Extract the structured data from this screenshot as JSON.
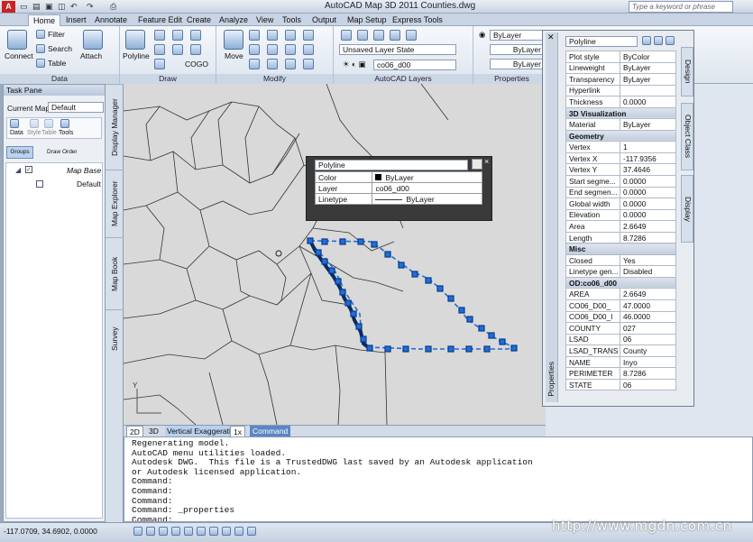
{
  "title_bar": {
    "title": "AutoCAD Map 3D 2011    Counties.dwg",
    "search_placeholder": "Type a keyword or phrase",
    "app_letter": "A"
  },
  "ribbon_tabs": [
    "Home",
    "Insert",
    "Annotate",
    "Feature Edit",
    "Create",
    "Analyze",
    "View",
    "Tools",
    "Output",
    "Map Setup",
    "Express Tools"
  ],
  "ribbon": {
    "data": {
      "label": "Data",
      "connect": "Connect",
      "filter": "Filter",
      "search": "Search",
      "table": "Table",
      "attach": "Attach"
    },
    "draw": {
      "label": "Draw",
      "polyline": "Polyline",
      "cogo": "COGO"
    },
    "modify": {
      "label": "Modify",
      "move": "Move"
    },
    "layers": {
      "label": "AutoCAD Layers",
      "layer_state": "Unsaved Layer State",
      "current_layer": "co06_d00"
    },
    "properties": {
      "label": "Properties",
      "color": "ByLayer",
      "lineweight": "ByLayer",
      "linetype": "ByLayer"
    }
  },
  "task_pane": {
    "title": "Task Pane",
    "current_map_label": "Current Map:",
    "current_map": "Default",
    "tools": [
      "Data",
      "Style",
      "Table",
      "Tools"
    ],
    "groups_btn": "Groups",
    "draw_order_btn": "Draw Order",
    "tree": [
      {
        "label": "Map Base"
      },
      {
        "label": "Default"
      }
    ]
  },
  "side_tabs": [
    "Display Manager",
    "Map Explorer",
    "Map Book",
    "Survey"
  ],
  "quick_props": {
    "type": "Polyline",
    "rows": [
      {
        "k": "Color",
        "v": "ByLayer"
      },
      {
        "k": "Layer",
        "v": "co06_d00"
      },
      {
        "k": "Linetype",
        "v": "ByLayer"
      }
    ]
  },
  "properties_palette": {
    "type": "Polyline",
    "vertical_title": "Properties",
    "right_tabs": [
      "Design",
      "Object Class",
      "Display"
    ],
    "rows": [
      {
        "k": "Plot style",
        "v": "ByColor"
      },
      {
        "k": "Lineweight",
        "v": "ByLayer"
      },
      {
        "k": "Transparency",
        "v": "ByLayer"
      },
      {
        "k": "Hyperlink",
        "v": ""
      },
      {
        "k": "Thickness",
        "v": "0.0000"
      },
      {
        "section": "3D Visualization"
      },
      {
        "k": "Material",
        "v": "ByLayer"
      },
      {
        "section": "Geometry"
      },
      {
        "k": "Vertex",
        "v": "1"
      },
      {
        "k": "Vertex X",
        "v": "-117.9356"
      },
      {
        "k": "Vertex Y",
        "v": "37.4646"
      },
      {
        "k": "Start segme...",
        "v": "0.0000"
      },
      {
        "k": "End segmen...",
        "v": "0.0000"
      },
      {
        "k": "Global width",
        "v": "0.0000"
      },
      {
        "k": "Elevation",
        "v": "0.0000"
      },
      {
        "k": "Area",
        "v": "2.6649"
      },
      {
        "k": "Length",
        "v": "8.7286"
      },
      {
        "section": "Misc"
      },
      {
        "k": "Closed",
        "v": "Yes"
      },
      {
        "k": "Linetype gen...",
        "v": "Disabled"
      },
      {
        "section": "OD:co06_d00"
      },
      {
        "k": "AREA",
        "v": "2.6649"
      },
      {
        "k": "CO06_D00_",
        "v": "47.0000"
      },
      {
        "k": "CO06_D00_I",
        "v": "46.0000"
      },
      {
        "k": "COUNTY",
        "v": "027"
      },
      {
        "k": "LSAD",
        "v": "06"
      },
      {
        "k": "LSAD_TRANS",
        "v": "County"
      },
      {
        "k": "NAME",
        "v": "Inyo"
      },
      {
        "k": "PERIMETER",
        "v": "8.7286"
      },
      {
        "k": "STATE",
        "v": "06"
      }
    ]
  },
  "status": {
    "mode2d": "2D",
    "mode3d": "3D",
    "vert_exag_label": "Vertical Exaggeration:",
    "vert_exag": "1x",
    "command_tab": "Command"
  },
  "command_lines": [
    "Regenerating model.",
    "AutoCAD menu utilities loaded.",
    "Autodesk DWG.  This file is a TrustedDWG last saved by an Autodesk application",
    "or Autodesk licensed application.",
    "Command:",
    "Command:",
    "Command:",
    "Command: _properties",
    "Command:"
  ],
  "coords": "-117.0709, 34.6902, 0.0000",
  "watermark": "http://www.mgdn.com.cn"
}
